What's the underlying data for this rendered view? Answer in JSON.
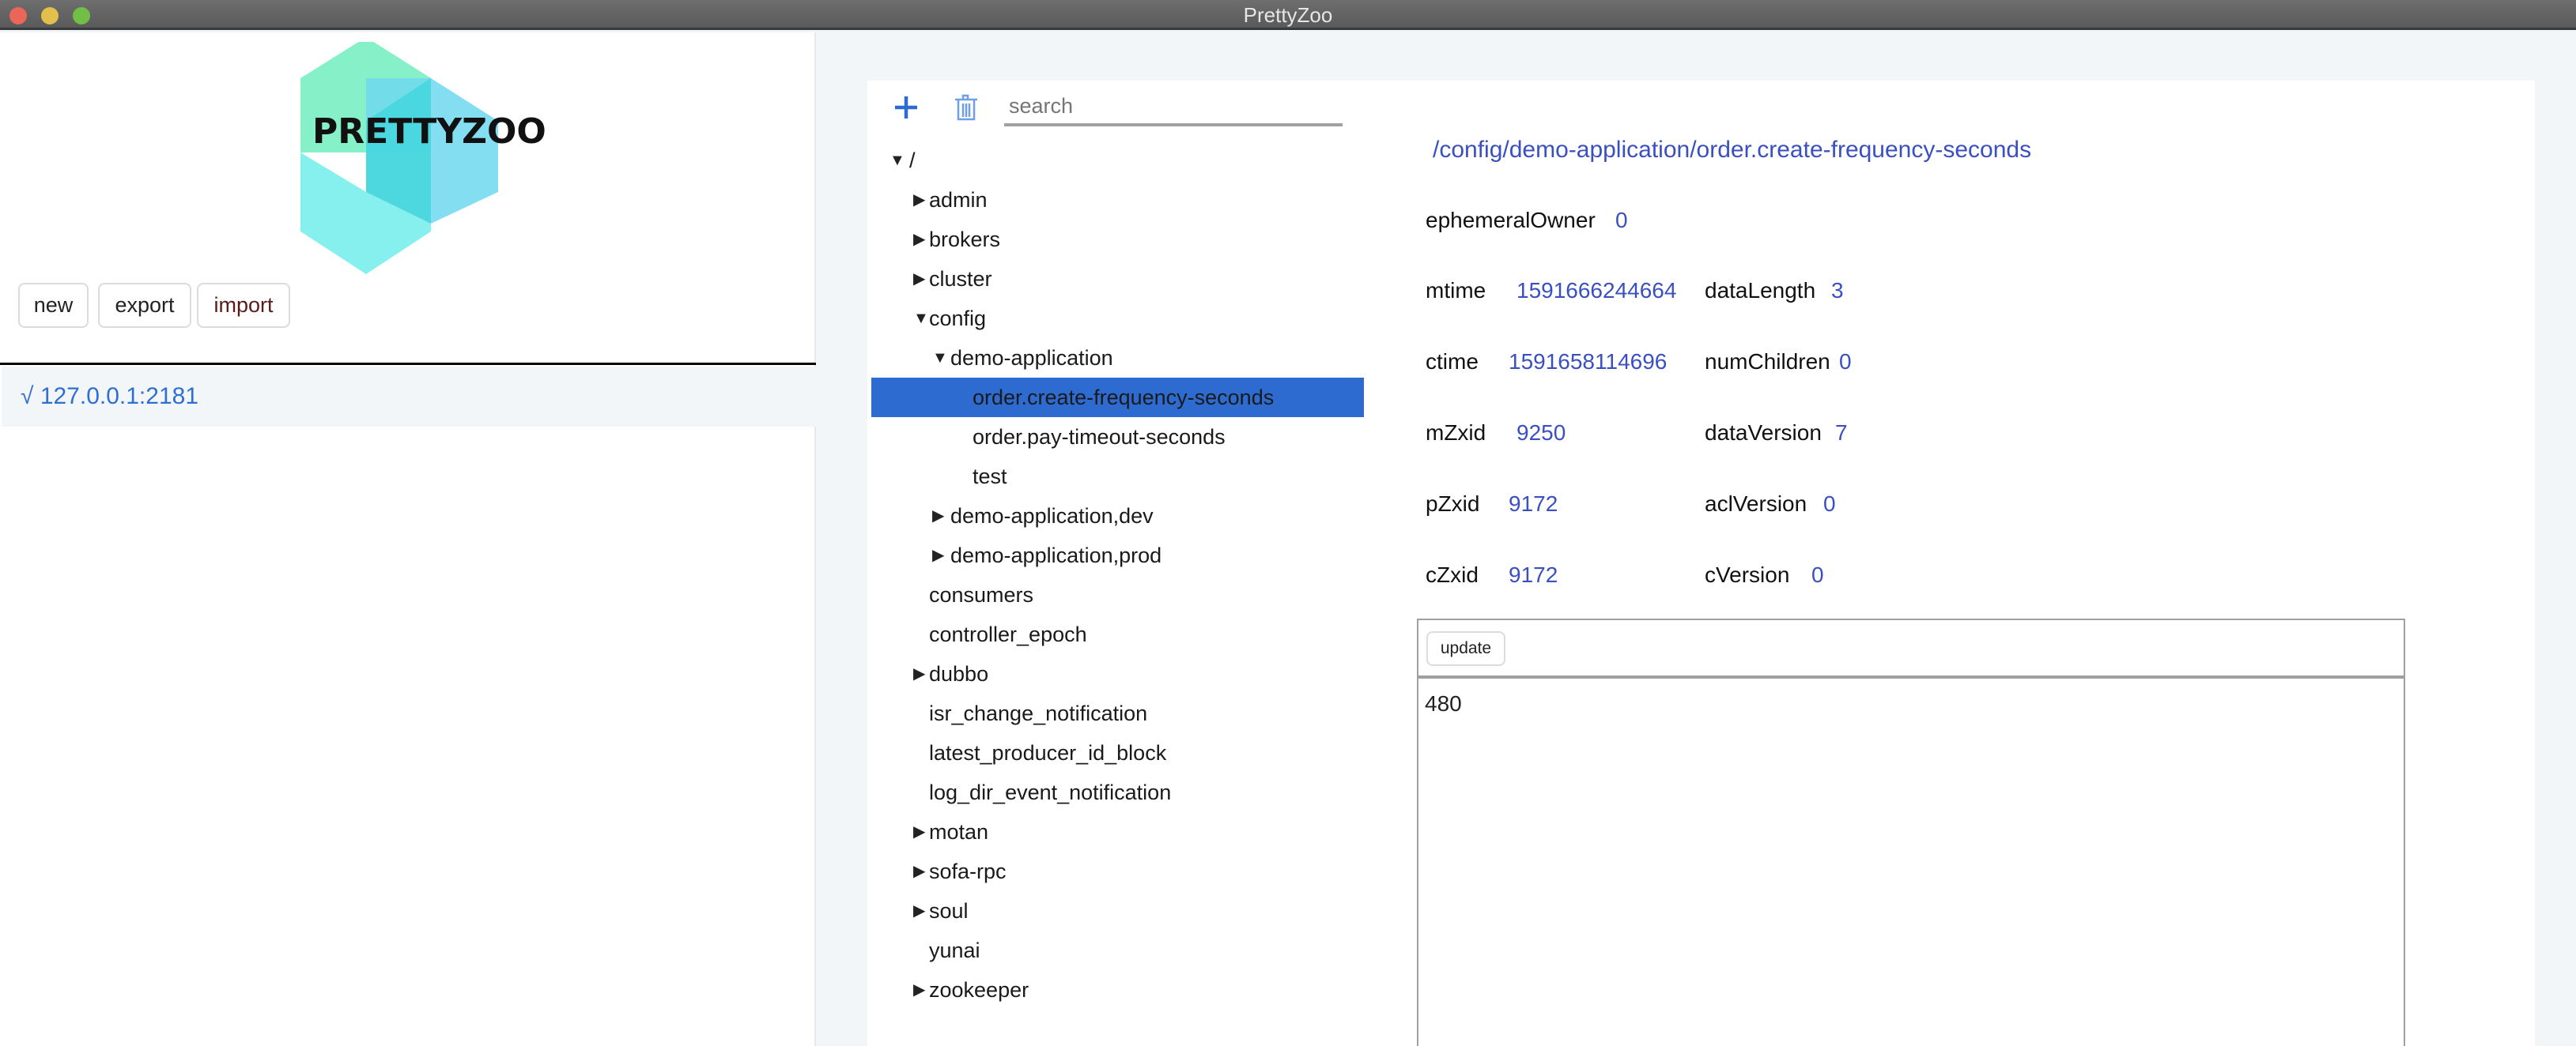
{
  "window": {
    "title": "PrettyZoo"
  },
  "sidebar": {
    "logo_text": "PRETTYZOO",
    "buttons": {
      "new": "new",
      "export": "export",
      "import": "import"
    },
    "connection": {
      "check": "√",
      "address": "127.0.0.1:2181"
    }
  },
  "toolbar": {
    "search_placeholder": "search"
  },
  "tree": [
    {
      "label": "/",
      "level": 0,
      "state": "expanded"
    },
    {
      "label": "admin",
      "level": 1,
      "state": "collapsed"
    },
    {
      "label": "brokers",
      "level": 1,
      "state": "collapsed"
    },
    {
      "label": "cluster",
      "level": 1,
      "state": "collapsed"
    },
    {
      "label": "config",
      "level": 1,
      "state": "expanded"
    },
    {
      "label": "demo-application",
      "level": 2,
      "state": "expanded"
    },
    {
      "label": "order.create-frequency-seconds",
      "level": 3,
      "state": "leaf",
      "selected": true
    },
    {
      "label": "order.pay-timeout-seconds",
      "level": 3,
      "state": "leaf"
    },
    {
      "label": "test",
      "level": 3,
      "state": "leaf"
    },
    {
      "label": "demo-application,dev",
      "level": 2,
      "state": "collapsed"
    },
    {
      "label": "demo-application,prod",
      "level": 2,
      "state": "collapsed"
    },
    {
      "label": "consumers",
      "level": 1,
      "state": "leaf"
    },
    {
      "label": "controller_epoch",
      "level": 1,
      "state": "leaf"
    },
    {
      "label": "dubbo",
      "level": 1,
      "state": "collapsed"
    },
    {
      "label": "isr_change_notification",
      "level": 1,
      "state": "leaf"
    },
    {
      "label": "latest_producer_id_block",
      "level": 1,
      "state": "leaf"
    },
    {
      "label": "log_dir_event_notification",
      "level": 1,
      "state": "leaf"
    },
    {
      "label": "motan",
      "level": 1,
      "state": "collapsed"
    },
    {
      "label": "sofa-rpc",
      "level": 1,
      "state": "collapsed"
    },
    {
      "label": "soul",
      "level": 1,
      "state": "collapsed"
    },
    {
      "label": "yunai",
      "level": 1,
      "state": "leaf"
    },
    {
      "label": "zookeeper",
      "level": 1,
      "state": "collapsed"
    }
  ],
  "detail": {
    "path": "/config/demo-application/order.create-frequency-seconds",
    "stats_left": [
      {
        "label": "ephemeralOwner",
        "value": "0"
      },
      {
        "label": "mtime",
        "value": "1591666244664"
      },
      {
        "label": "ctime",
        "value": "1591658114696"
      },
      {
        "label": "mZxid",
        "value": "9250"
      },
      {
        "label": "pZxid",
        "value": "9172"
      },
      {
        "label": "cZxid",
        "value": "9172"
      }
    ],
    "stats_right": [
      {
        "label": "dataLength",
        "value": "3"
      },
      {
        "label": "numChildren",
        "value": "0"
      },
      {
        "label": "dataVersion",
        "value": "7"
      },
      {
        "label": "aclVersion",
        "value": "0"
      },
      {
        "label": "cVersion",
        "value": "0"
      }
    ],
    "update_label": "update",
    "data": "480"
  },
  "colors": {
    "accent": "#2d6bd1",
    "value": "#3a4fc0"
  }
}
